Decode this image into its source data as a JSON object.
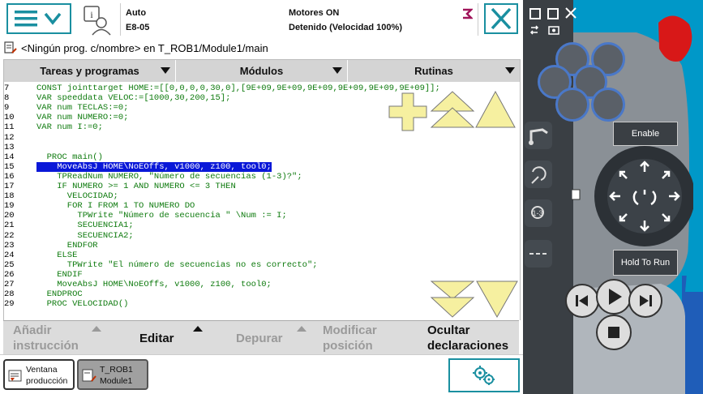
{
  "header": {
    "mode": "Auto",
    "system": "E8-05",
    "motors": "Motores ON",
    "state": "Detenido (Velocidad 100%)"
  },
  "breadcrumb": "<Ningún prog. c/nombre> en T_ROB1/Module1/main",
  "tabs": [
    {
      "label": "Tareas y programas"
    },
    {
      "label": "Módulos"
    },
    {
      "label": "Rutinas"
    }
  ],
  "code": [
    {
      "n": "7",
      "t": "CONST jointtarget HOME:=[[0,0,0,0,30,0],[9E+09,9E+09,9E+09,9E+09,9E+09,9E+09]];"
    },
    {
      "n": "8",
      "t": "VAR speeddata VELOC:=[1000,30,200,15];"
    },
    {
      "n": "9",
      "t": "VAR num TECLAS:=0;"
    },
    {
      "n": "10",
      "t": "VAR num NUMERO:=0;"
    },
    {
      "n": "11",
      "t": "VAR num I:=0;"
    },
    {
      "n": "12",
      "t": ""
    },
    {
      "n": "13",
      "t": ""
    },
    {
      "n": "14",
      "t": "  PROC main()"
    },
    {
      "n": "15",
      "t": "    MoveAbsJ HOME\\NoEOffs, v1000, z100, tool0;",
      "hl": true
    },
    {
      "n": "16",
      "t": "    TPReadNum NUMERO, \"Número de secuencias (1-3)?\";"
    },
    {
      "n": "17",
      "t": "    IF NUMERO >= 1 AND NUMERO <= 3 THEN"
    },
    {
      "n": "18",
      "t": "      VELOCIDAD;"
    },
    {
      "n": "19",
      "t": "      FOR I FROM 1 TO NUMERO DO"
    },
    {
      "n": "20",
      "t": "        TPWrite \"Número de secuencia \" \\Num := I;"
    },
    {
      "n": "21",
      "t": "        SECUENCIA1;"
    },
    {
      "n": "22",
      "t": "        SECUENCIA2;"
    },
    {
      "n": "23",
      "t": "      ENDFOR"
    },
    {
      "n": "24",
      "t": "    ELSE"
    },
    {
      "n": "25",
      "t": "      TPWrite \"El número de secuencias no es correcto\";"
    },
    {
      "n": "26",
      "t": "    ENDIF"
    },
    {
      "n": "27",
      "t": "    MoveAbsJ HOME\\NoEOffs, v1000, z100, tool0;"
    },
    {
      "n": "28",
      "t": "  ENDPROC"
    },
    {
      "n": "29",
      "t": "  PROC VELOCIDAD()"
    }
  ],
  "actions": [
    {
      "line1": "Añadir",
      "line2": "instrucción"
    },
    {
      "line1": "Editar",
      "line2": ""
    },
    {
      "line1": "Depurar",
      "line2": ""
    },
    {
      "line1": "Modificar",
      "line2": "posición"
    },
    {
      "line1": "Ocultar",
      "line2": "declaraciones"
    }
  ],
  "taskbar": {
    "prod_line1": "Ventana",
    "prod_line2": "producción",
    "mod_line1": "T_ROB1",
    "mod_line2": "Module1"
  },
  "flexpendant": {
    "enable_label": "Enable",
    "hold_label": "Hold To Run"
  },
  "colors": {
    "accent": "#1a8fa0",
    "code_green": "#0d7a0d",
    "highlight": "#0a18d8",
    "pendant_blue": "#0098c8",
    "scroll_yellow": "#f6f0a0"
  }
}
